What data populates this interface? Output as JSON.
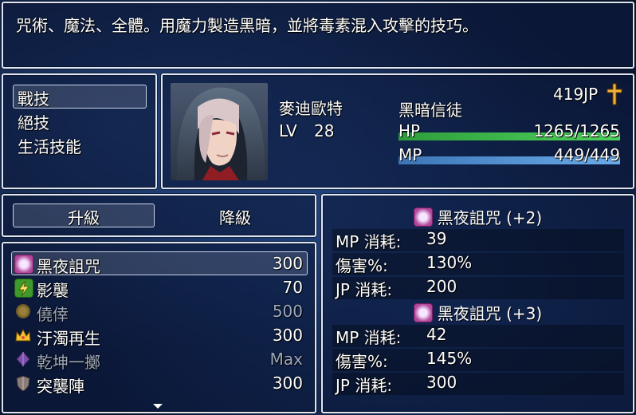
{
  "help": {
    "text": "咒術、魔法、全體。用魔力製造黑暗，並將毒素混入攻擊的技巧。"
  },
  "categories": {
    "items": [
      {
        "label": "戰技",
        "selected": true
      },
      {
        "label": "絕技"
      },
      {
        "label": "生活技能"
      }
    ]
  },
  "status": {
    "name": "麥迪歐特",
    "level_label": "LV",
    "level": "28",
    "class": "黑暗信徒",
    "jp": "419JP",
    "hp_label": "HP",
    "hp": "1265/1265",
    "hp_fraction": 1.0,
    "mp_label": "MP",
    "mp": "449/449",
    "mp_fraction": 1.0,
    "hp_color": "#3fb846",
    "mp_color": "#4f8fd0"
  },
  "mode": {
    "upgrade": "升級",
    "downgrade": "降級"
  },
  "skills": [
    {
      "icon": "book-icon",
      "name": "黑夜詛咒",
      "cost": "300",
      "enabled": true,
      "selected": true
    },
    {
      "icon": "lightning-icon",
      "name": "影襲",
      "cost": "70",
      "enabled": true
    },
    {
      "icon": "coin-icon",
      "name": "僥倖",
      "cost": "500",
      "enabled": false
    },
    {
      "icon": "crown-icon",
      "name": "汙濁再生",
      "cost": "300",
      "enabled": true
    },
    {
      "icon": "gem-icon",
      "name": "乾坤一擲",
      "cost": "Max",
      "enabled": false
    },
    {
      "icon": "shield-icon",
      "name": "突襲陣",
      "cost": "300",
      "enabled": true
    }
  ],
  "detail": {
    "next1": {
      "title": "黑夜詛咒 (+2)",
      "rows": [
        {
          "label": "MP 消耗:",
          "value": "39"
        },
        {
          "label": "傷害%:",
          "value": "130%"
        },
        {
          "label": "JP 消耗:",
          "value": "200"
        }
      ]
    },
    "next2": {
      "title": "黑夜詛咒 (+3)",
      "rows": [
        {
          "label": "MP 消耗:",
          "value": "42"
        },
        {
          "label": "傷害%:",
          "value": "145%"
        },
        {
          "label": "JP 消耗:",
          "value": "300"
        }
      ]
    }
  }
}
